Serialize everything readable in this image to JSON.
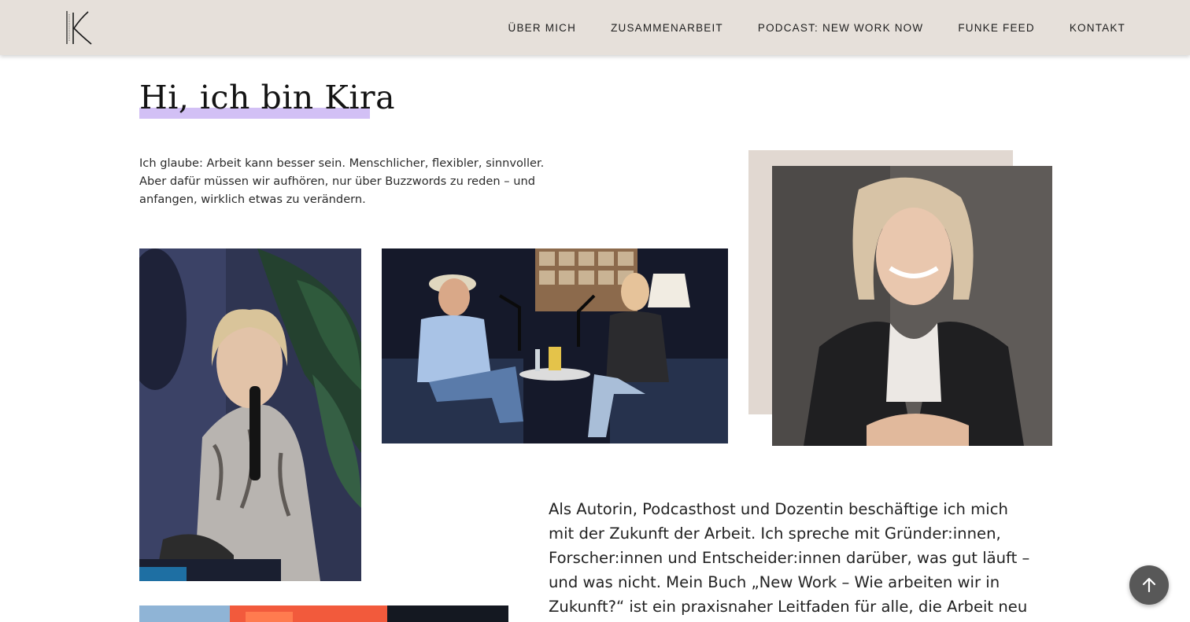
{
  "header": {
    "logo_icon": "kira-k-monogram-logo",
    "nav": [
      {
        "label": "ÜBER MICH"
      },
      {
        "label": "ZUSAMMENARBEIT"
      },
      {
        "label": "PODCAST: NEW WORK NOW"
      },
      {
        "label": "FUNKE FEED"
      },
      {
        "label": "KONTAKT"
      }
    ]
  },
  "main": {
    "headline": "Hi, ich bin Kira",
    "intro": "Ich glaube: Arbeit kann besser sein. Menschlicher, flexibler, sinnvoller. Aber dafür müssen wir aufhören, nur über Buzzwords zu reden – und anfangen, wirklich etwas zu verändern.",
    "body": "Als Autorin, Podcasthost und Dozentin beschäftige ich mich mit der Zukunft der Arbeit. Ich spreche mit Gründer:innen, Forscher:innen und Entscheider:innen darüber, was gut läuft – und was nicht. Mein Buch „New Work – Wie arbeiten wir in Zukunft?“ ist ein praxisnaher Leitfaden für alle, die Arbeit neu"
  },
  "colors": {
    "header_bg": "#e6e0da",
    "highlight": "#d2c0f5",
    "portrait_frame": "#e1d8d1",
    "scroll_button": "#585858"
  },
  "scroll_top_icon": "arrow-up-icon"
}
